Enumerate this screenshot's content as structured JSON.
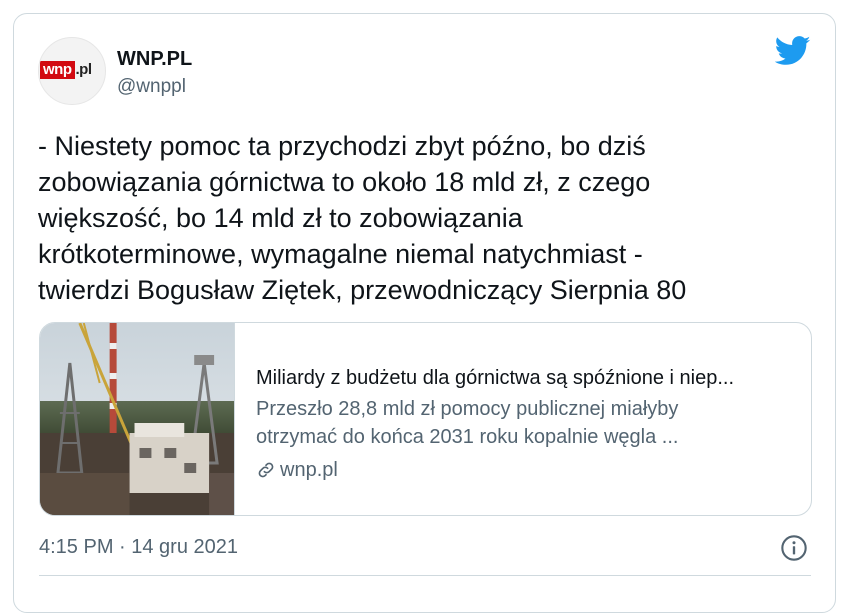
{
  "tweet": {
    "author": {
      "name": "WNP.PL",
      "handle": "@wnppl",
      "avatar_logo": {
        "red_part": "wnp",
        "rest_part": ".pl"
      }
    },
    "text_lines": [
      "- Niestety pomoc ta przychodzi zbyt późno, bo dziś",
      "zobowiązania górnictwa to około 18 mld zł, z czego",
      "większość, bo 14 mld zł to zobowiązania",
      "krótkoterminowe, wymagalne niemal natychmiast -",
      "twierdzi Bogusław Ziętek, przewodniczący Sierpnia 80"
    ],
    "link_card": {
      "title": "Miliardy z budżetu dla górnictwa są spóźnione i niep...",
      "description_lines": [
        "Przeszło 28,8 mld zł pomocy publicznej miałyby",
        "otrzymać do końca 2031 roku kopalnie węgla ..."
      ],
      "domain": "wnp.pl",
      "thumbnail_icon": "mine-photo"
    },
    "timestamp": "4:15 PM · 14 gru 2021",
    "icons": {
      "brand": "twitter-bird-icon",
      "info": "info-icon",
      "link": "link-icon"
    },
    "colors": {
      "twitter_blue": "#1d9bf0",
      "text": "#0f1419",
      "secondary": "#536471",
      "border": "#cfd9de",
      "wnp_red": "#d20a11"
    }
  }
}
